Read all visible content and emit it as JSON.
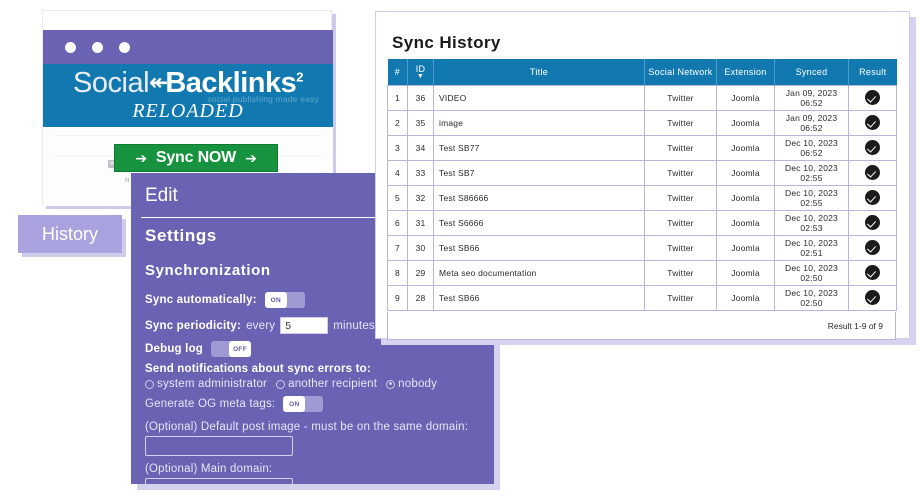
{
  "app_window": {
    "logo": {
      "social": "Social",
      "arrow_glyph": "↞",
      "backlinks": "Backlinks",
      "superscript": "2",
      "tagline": "social publishing made easy",
      "reloaded": "RELOADED"
    },
    "sync_now_button": {
      "label": "Sync NOW",
      "left_arrow": "➔",
      "right_arrow": "➔"
    },
    "ghost": {
      "chip": "W",
      "text": "N"
    }
  },
  "history_button": {
    "label": "History"
  },
  "settings_panel": {
    "edit_title": "Edit",
    "settings_heading": "Settings",
    "synchronization_heading": "Synchronization",
    "sync_automatically": {
      "label": "Sync automatically:",
      "toggle_state": "ON"
    },
    "sync_periodicity": {
      "label": "Sync periodicity:",
      "every": "every",
      "value": "5",
      "unit": "minutes"
    },
    "debug_log": {
      "label": "Debug log",
      "toggle_state": "OFF"
    },
    "notifications": {
      "label": "Send notifications about sync errors to:",
      "options": [
        {
          "label": "system administrator",
          "checked": false
        },
        {
          "label": "another recipient",
          "checked": false
        },
        {
          "label": "nobody",
          "checked": true
        }
      ]
    },
    "og_meta_tags": {
      "label": "Generate OG meta tags:",
      "toggle_state": "ON"
    },
    "default_post_image": {
      "label": "(Optional) Default post image - must be on the same domain:",
      "value": ""
    },
    "main_domain": {
      "label": "(Optional) Main domain:",
      "value": ""
    }
  },
  "sync_history": {
    "title": "Sync History",
    "columns": [
      "#",
      "ID",
      "Title",
      "Social Network",
      "Extension",
      "Synced",
      "Result"
    ],
    "sort_column": "ID",
    "sort_caret": "▼",
    "rows": [
      {
        "num": "1",
        "id": "36",
        "title": "VIDEO",
        "network": "Twitter",
        "extension": "Joomla",
        "synced": "Jan 09, 2023 06:52",
        "result": "success"
      },
      {
        "num": "2",
        "id": "35",
        "title": "image",
        "network": "Twitter",
        "extension": "Joomla",
        "synced": "Jan 09, 2023 06:52",
        "result": "success"
      },
      {
        "num": "3",
        "id": "34",
        "title": "Test SB77",
        "network": "Twitter",
        "extension": "Joomla",
        "synced": "Dec 10, 2023 06:52",
        "result": "success"
      },
      {
        "num": "4",
        "id": "33",
        "title": "Test SB7",
        "network": "Twitter",
        "extension": "Joomla",
        "synced": "Dec 10, 2023 02:55",
        "result": "success"
      },
      {
        "num": "5",
        "id": "32",
        "title": "Test S86666",
        "network": "Twitter",
        "extension": "Joomla",
        "synced": "Dec 10, 2023 02:55",
        "result": "success"
      },
      {
        "num": "6",
        "id": "31",
        "title": "Test S6666",
        "network": "Twitter",
        "extension": "Joomla",
        "synced": "Dec 10, 2023 02:53",
        "result": "success"
      },
      {
        "num": "7",
        "id": "30",
        "title": "Test SB66",
        "network": "Twitter",
        "extension": "Joomla",
        "synced": "Dec 10, 2023 02:51",
        "result": "success"
      },
      {
        "num": "8",
        "id": "29",
        "title": "Meta seo documentation",
        "network": "Twitter",
        "extension": "Joomla",
        "synced": "Dec 10, 2023 02:50",
        "result": "success"
      },
      {
        "num": "9",
        "id": "28",
        "title": "Test SB66",
        "network": "Twitter",
        "extension": "Joomla",
        "synced": "Dec 10, 2023 02:50",
        "result": "success"
      }
    ],
    "result_footer": "Result 1-9 of 9"
  },
  "colors": {
    "purple": "#6a62b3",
    "purple_light": "#a8a2de",
    "blue": "#1279b0",
    "green": "#17923e",
    "shadow": "#d5d2ef"
  }
}
